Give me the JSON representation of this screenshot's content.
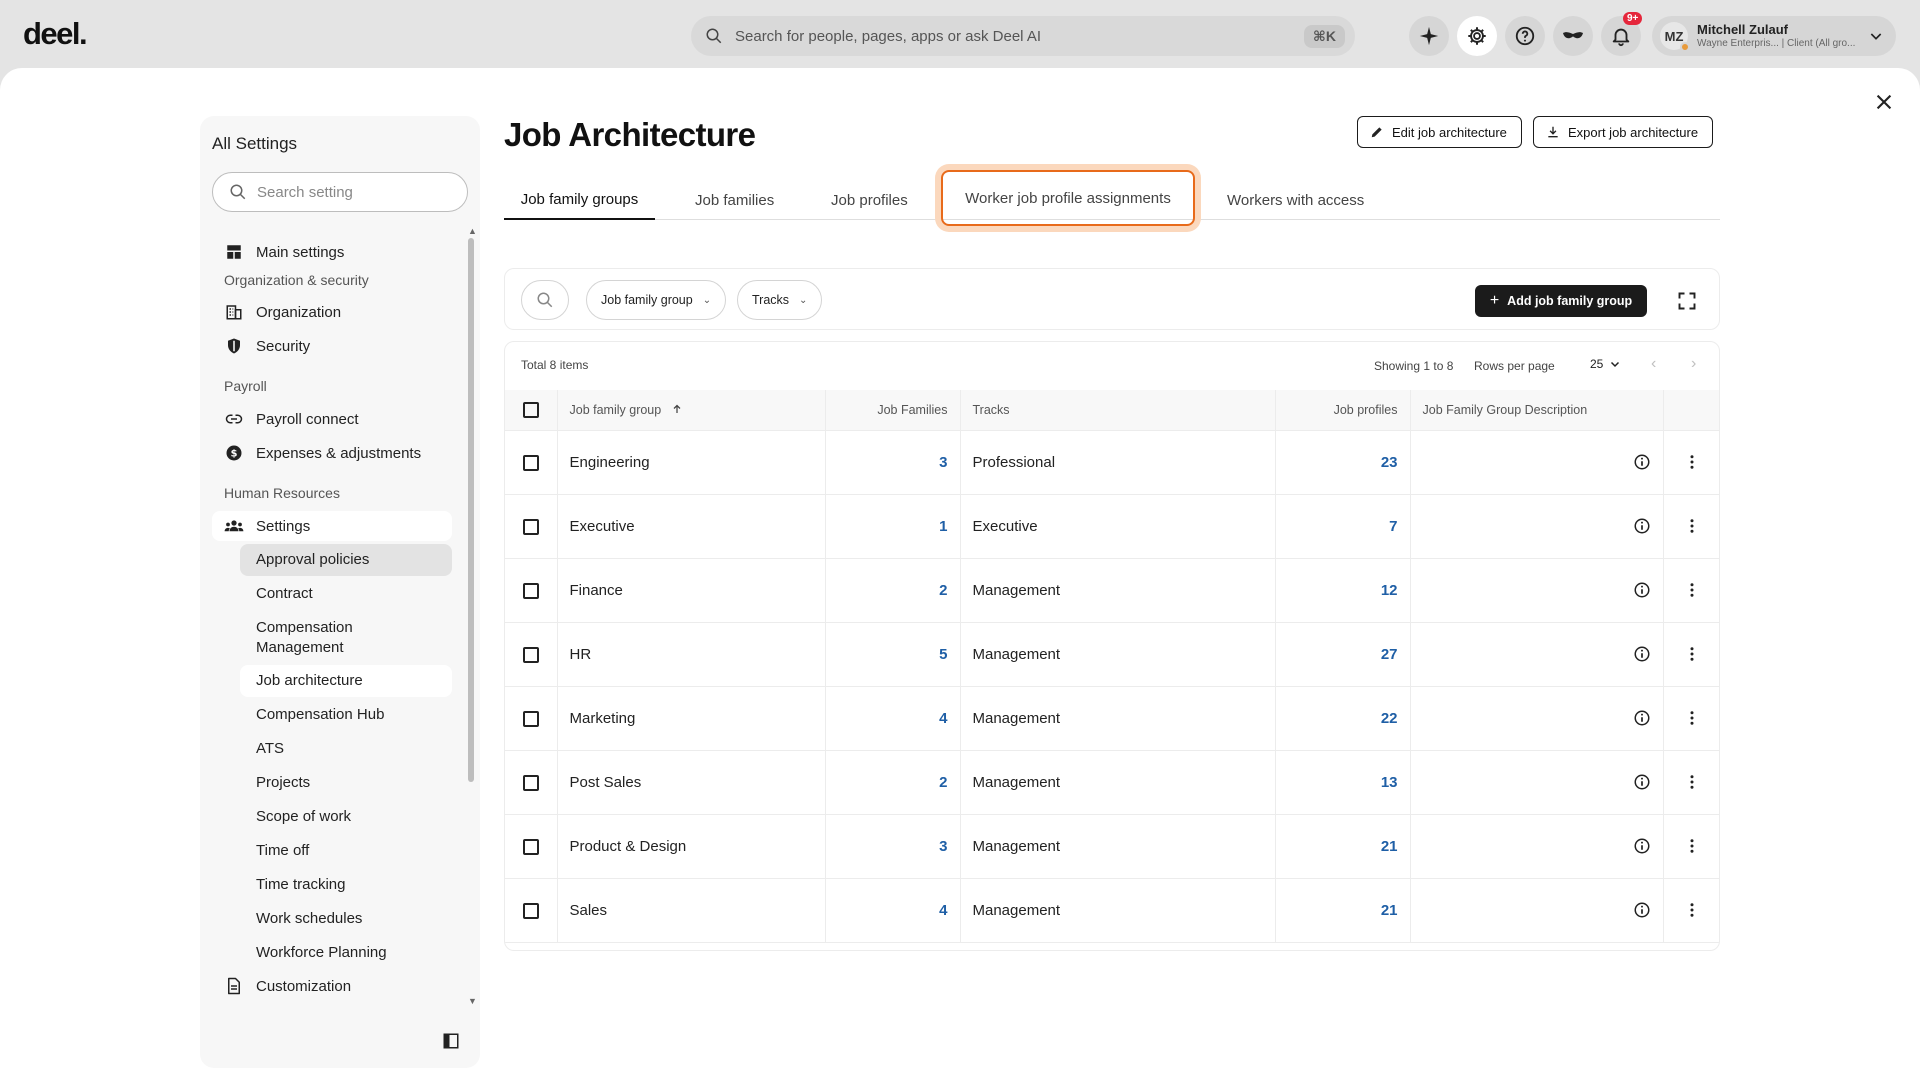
{
  "app": {
    "logo": "deel.",
    "search_placeholder": "Search for people, pages, apps or ask Deel AI",
    "search_shortcut": "⌘K",
    "notification_count": "9+",
    "user": {
      "initials": "MZ",
      "name": "Mitchell Zulauf",
      "subtitle": "Wayne Enterpris... | Client (All gro..."
    }
  },
  "sidebar": {
    "title": "All Settings",
    "search_placeholder": "Search setting",
    "main_settings": "Main settings",
    "sections": {
      "org": "Organization & security",
      "payroll": "Payroll",
      "hr": "Human Resources"
    },
    "items": {
      "organization": "Organization",
      "security": "Security",
      "payroll_connect": "Payroll connect",
      "expenses": "Expenses & adjustments",
      "settings": "Settings",
      "customization": "Customization"
    },
    "hr_sub": [
      "Approval policies",
      "Contract",
      "Compensation Management",
      "Job architecture",
      "Compensation Hub",
      "ATS",
      "Projects",
      "Scope of work",
      "Time off",
      "Time tracking",
      "Work schedules",
      "Workforce Planning"
    ]
  },
  "page": {
    "title": "Job Architecture",
    "edit_button": "Edit job architecture",
    "export_button": "Export job architecture",
    "tabs": [
      "Job family groups",
      "Job families",
      "Job profiles",
      "Worker job profile assignments",
      "Workers with access"
    ],
    "filters": {
      "group": "Job family group",
      "tracks": "Tracks"
    },
    "add_button": "Add job family group"
  },
  "table": {
    "total": "Total 8 items",
    "showing": "Showing 1 to 8",
    "rows_per_page_label": "Rows per page",
    "rows_per_page": "25",
    "columns": [
      "Job family group",
      "Job Families",
      "Tracks",
      "Job profiles",
      "Job Family Group Description"
    ],
    "rows": [
      {
        "group": "Engineering",
        "families": "3",
        "tracks": "Professional",
        "profiles": "23"
      },
      {
        "group": "Executive",
        "families": "1",
        "tracks": "Executive",
        "profiles": "7"
      },
      {
        "group": "Finance",
        "families": "2",
        "tracks": "Management",
        "profiles": "12"
      },
      {
        "group": "HR",
        "families": "5",
        "tracks": "Management",
        "profiles": "27"
      },
      {
        "group": "Marketing",
        "families": "4",
        "tracks": "Management",
        "profiles": "22"
      },
      {
        "group": "Post Sales",
        "families": "2",
        "tracks": "Management",
        "profiles": "13"
      },
      {
        "group": "Product & Design",
        "families": "3",
        "tracks": "Management",
        "profiles": "21"
      },
      {
        "group": "Sales",
        "families": "4",
        "tracks": "Management",
        "profiles": "21"
      }
    ]
  }
}
